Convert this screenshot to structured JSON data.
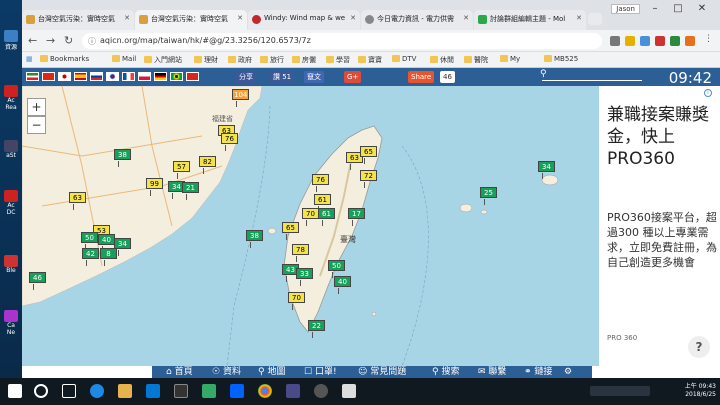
{
  "desktop": {
    "labels": [
      "資源",
      "Ac",
      "Rea",
      "aSt",
      "Ac",
      "DC",
      "Ble",
      "Ca",
      "Ne"
    ]
  },
  "tabs": [
    {
      "title": "台灣空氣污染：實時空氣"
    },
    {
      "title": "台灣空氣污染：實時空氣"
    },
    {
      "title": "Windy: Wind map & we"
    },
    {
      "title": "今日電力資訊 - 電力供需"
    },
    {
      "title": "討論群組編輯主題 - Mol"
    }
  ],
  "user": "Jason",
  "url": "aqicn.org/map/taiwan/hk/#@g/23.3256/120.6573/7z",
  "bookmarks": [
    "Bookmarks",
    "Mail",
    "入門網站",
    "理財",
    "政府",
    "旅行",
    "房儷",
    "學習",
    "寶寶",
    "DTV",
    "休閒",
    "醫院",
    "My",
    "MB525"
  ],
  "aq": {
    "share": "分享",
    "like": "讚 51",
    "likehint": "竄文",
    "gplus": "G+",
    "sharebtn": "Share",
    "count": "46",
    "clock": "09:42"
  },
  "markers": [
    {
      "v": "104",
      "c": "#f7a13b"
    },
    {
      "v": "63",
      "c": "#f4e34a"
    },
    {
      "v": "76",
      "c": "#f4e34a"
    },
    {
      "v": "38",
      "c": "#17a05a"
    },
    {
      "v": "82",
      "c": "#f4e34a"
    },
    {
      "v": "57",
      "c": "#f4e34a"
    },
    {
      "v": "99",
      "c": "#f4e34a"
    },
    {
      "v": "34",
      "c": "#17a05a"
    },
    {
      "v": "21",
      "c": "#17a05a"
    },
    {
      "v": "63",
      "c": "#f4e34a"
    },
    {
      "v": "53",
      "c": "#f4e34a"
    },
    {
      "v": "50",
      "c": "#17a05a"
    },
    {
      "v": "40",
      "c": "#17a05a"
    },
    {
      "v": "34",
      "c": "#17a05a"
    },
    {
      "v": "42",
      "c": "#17a05a"
    },
    {
      "v": "8",
      "c": "#17a05a"
    },
    {
      "v": "46",
      "c": "#17a05a"
    },
    {
      "v": "63",
      "c": "#f4e34a"
    },
    {
      "v": "65",
      "c": "#f4e34a"
    },
    {
      "v": "72",
      "c": "#f4e34a"
    },
    {
      "v": "76",
      "c": "#f4e34a"
    },
    {
      "v": "61",
      "c": "#f4e34a"
    },
    {
      "v": "70",
      "c": "#f4e34a"
    },
    {
      "v": "61",
      "c": "#17a05a"
    },
    {
      "v": "65",
      "c": "#f4e34a"
    },
    {
      "v": "78",
      "c": "#f4e34a"
    },
    {
      "v": "38",
      "c": "#17a05a"
    },
    {
      "v": "17",
      "c": "#17a05a"
    },
    {
      "v": "43",
      "c": "#17a05a"
    },
    {
      "v": "33",
      "c": "#17a05a"
    },
    {
      "v": "50",
      "c": "#17a05a"
    },
    {
      "v": "40",
      "c": "#17a05a"
    },
    {
      "v": "70",
      "c": "#f4e34a"
    },
    {
      "v": "22",
      "c": "#17a05a"
    },
    {
      "v": "25",
      "c": "#17a05a"
    },
    {
      "v": "34",
      "c": "#17a05a"
    }
  ],
  "maplabels": [
    "福建省",
    "臺灣"
  ],
  "ad": {
    "headline": "兼職接案賺獎金，快上PRO360",
    "body": "PRO360接案平台，超過300 種以上專業需求，立即免費註冊，為自己創造更多機會",
    "footer": "PRO 360",
    "help": "?"
  },
  "footer": [
    "首頁",
    "資料",
    "地圖",
    "口罩!",
    "常見問題",
    "搜索",
    "聯繫",
    "鏈接"
  ],
  "taskbar": {
    "time": "上午 09:43",
    "date": "2018/6/25"
  }
}
